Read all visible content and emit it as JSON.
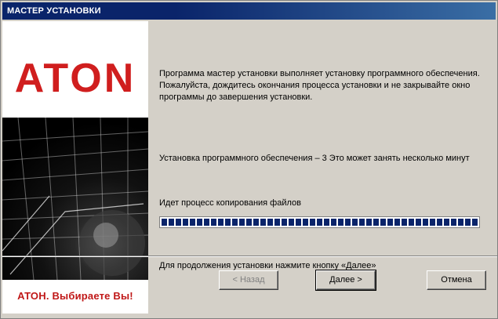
{
  "window": {
    "title": "МАСТЕР УСТАНОВКИ"
  },
  "left_panel": {
    "logo_text": "ATON",
    "caption": "АТОН. Выбираете Вы!"
  },
  "content": {
    "description": "Программа мастер установки выполняет установку программного обеспечения. Пожалуйста, дождитесь окончания процесса установки и не закрывайте окно программы до завершения установки.",
    "status": "Установка программного обеспечения – 3 Это может занять несколько минут",
    "progress_label": "Идет процесс копирования файлов",
    "progress_percent": 100,
    "hint": "Для продолжения установки нажмите кнопку «Далее»"
  },
  "buttons": {
    "back": "< Назад",
    "next": "Далее >",
    "cancel": "Отмена"
  },
  "colors": {
    "logo_red": "#d01e1e",
    "title_bar": "#0a246a",
    "progress_blocks": "#0a246a",
    "panel_bg": "#d4d0c8"
  }
}
